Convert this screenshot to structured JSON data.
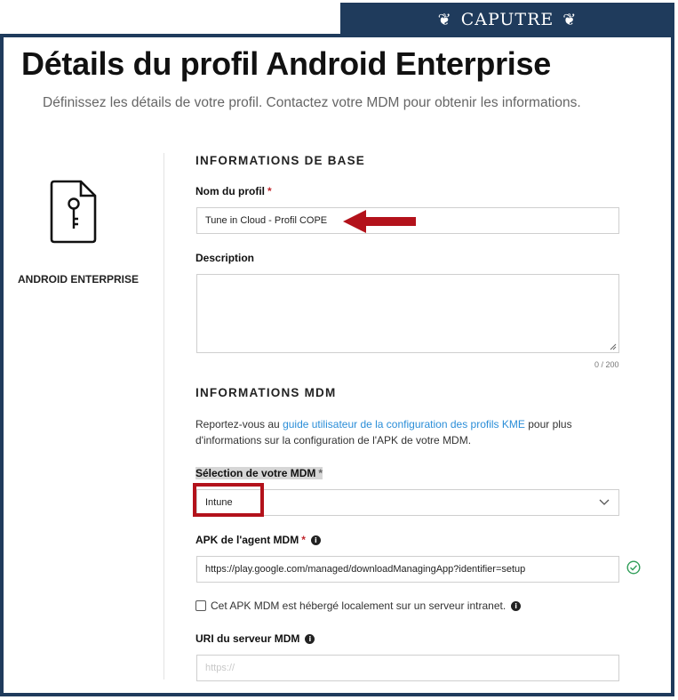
{
  "watermark": {
    "text": "CAPUTRE"
  },
  "page": {
    "title": "Détails du profil Android Enterprise",
    "subtitle": "Définissez les détails de votre profil. Contactez votre MDM pour obtenir les informations."
  },
  "sidebar": {
    "label": "ANDROID ENTERPRISE"
  },
  "basic_info": {
    "section_title": "INFORMATIONS DE BASE",
    "profile_name_label": "Nom du profil",
    "profile_name_value": "Tune in Cloud - Profil COPE",
    "description_label": "Description",
    "description_value": "",
    "description_counter": "0 / 200"
  },
  "mdm_info": {
    "section_title": "INFORMATIONS MDM",
    "text_before": "Reportez-vous au ",
    "link_text": "guide utilisateur de la configuration des profils KME",
    "text_after": " pour plus d'informations sur la configuration de l'APK de votre MDM.",
    "mdm_select_label": "Sélection de votre MDM",
    "mdm_select_value": "Intune",
    "apk_label": "APK de l'agent MDM",
    "apk_value": "https://play.google.com/managed/downloadManagingApp?identifier=setup",
    "intranet_checkbox_label": "Cet APK MDM est hébergé localement sur un serveur intranet.",
    "intranet_checked": false,
    "server_uri_label": "URI du serveur MDM",
    "server_uri_placeholder": "https://",
    "server_uri_value": ""
  },
  "required_marker": "*",
  "colors": {
    "frame": "#1f3b5c",
    "annotation_red": "#b3121b",
    "link": "#2b8ed8",
    "valid_green": "#2e9d57"
  },
  "icons": [
    "laurel-icon",
    "android-profile-key-icon",
    "chevron-down-icon",
    "info-icon",
    "check-circle-icon",
    "resize-handle-icon",
    "arrow-left-icon"
  ]
}
